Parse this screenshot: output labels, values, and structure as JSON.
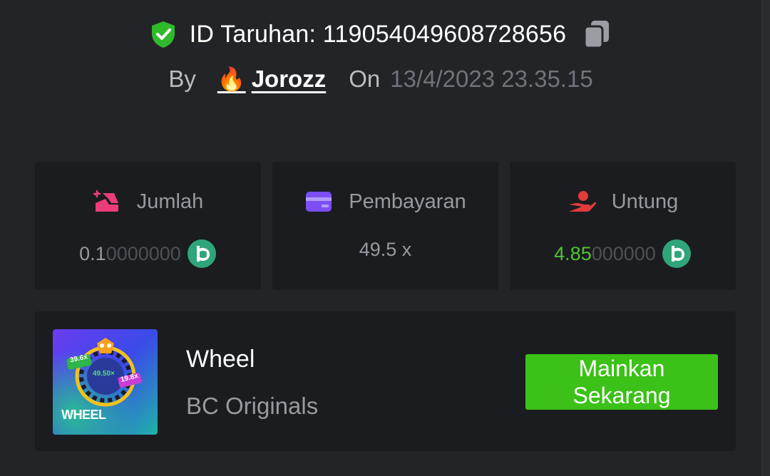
{
  "bet": {
    "id_label": "ID Taruhan:",
    "id_value": "11905404960872865​6",
    "by_label": "By",
    "user_name": "Jorozz",
    "user_emoji": "🔥",
    "on_label": "On",
    "date": "13/4/2023 23.35.15"
  },
  "stats": {
    "amount": {
      "label": "Jumlah",
      "value_main": "0.1",
      "value_dim": "0000000"
    },
    "payout": {
      "label": "Pembayaran",
      "value": "49.5 x"
    },
    "profit": {
      "label": "Untung",
      "value_main": "4.85",
      "value_dim": "000000"
    }
  },
  "game": {
    "name": "Wheel",
    "provider": "BC Originals",
    "thumb_title": "WHEEL",
    "thumb_badges": [
      "39.6x",
      "49.50×",
      "19.8x"
    ],
    "play_line1": "Mainkan",
    "play_line2": "Sekarang"
  },
  "colors": {
    "background": "#232427",
    "card": "#1b1c1f",
    "accent_green": "#3bc117",
    "profit_green": "#4ec531",
    "coin": "#2fa67a"
  },
  "icons": {
    "verified": "shield-check-icon",
    "copy": "copy-icon",
    "amount": "bet-amount-icon",
    "payout": "card-icon",
    "profit": "hand-coin-icon",
    "currency": "bc-coin-icon"
  }
}
